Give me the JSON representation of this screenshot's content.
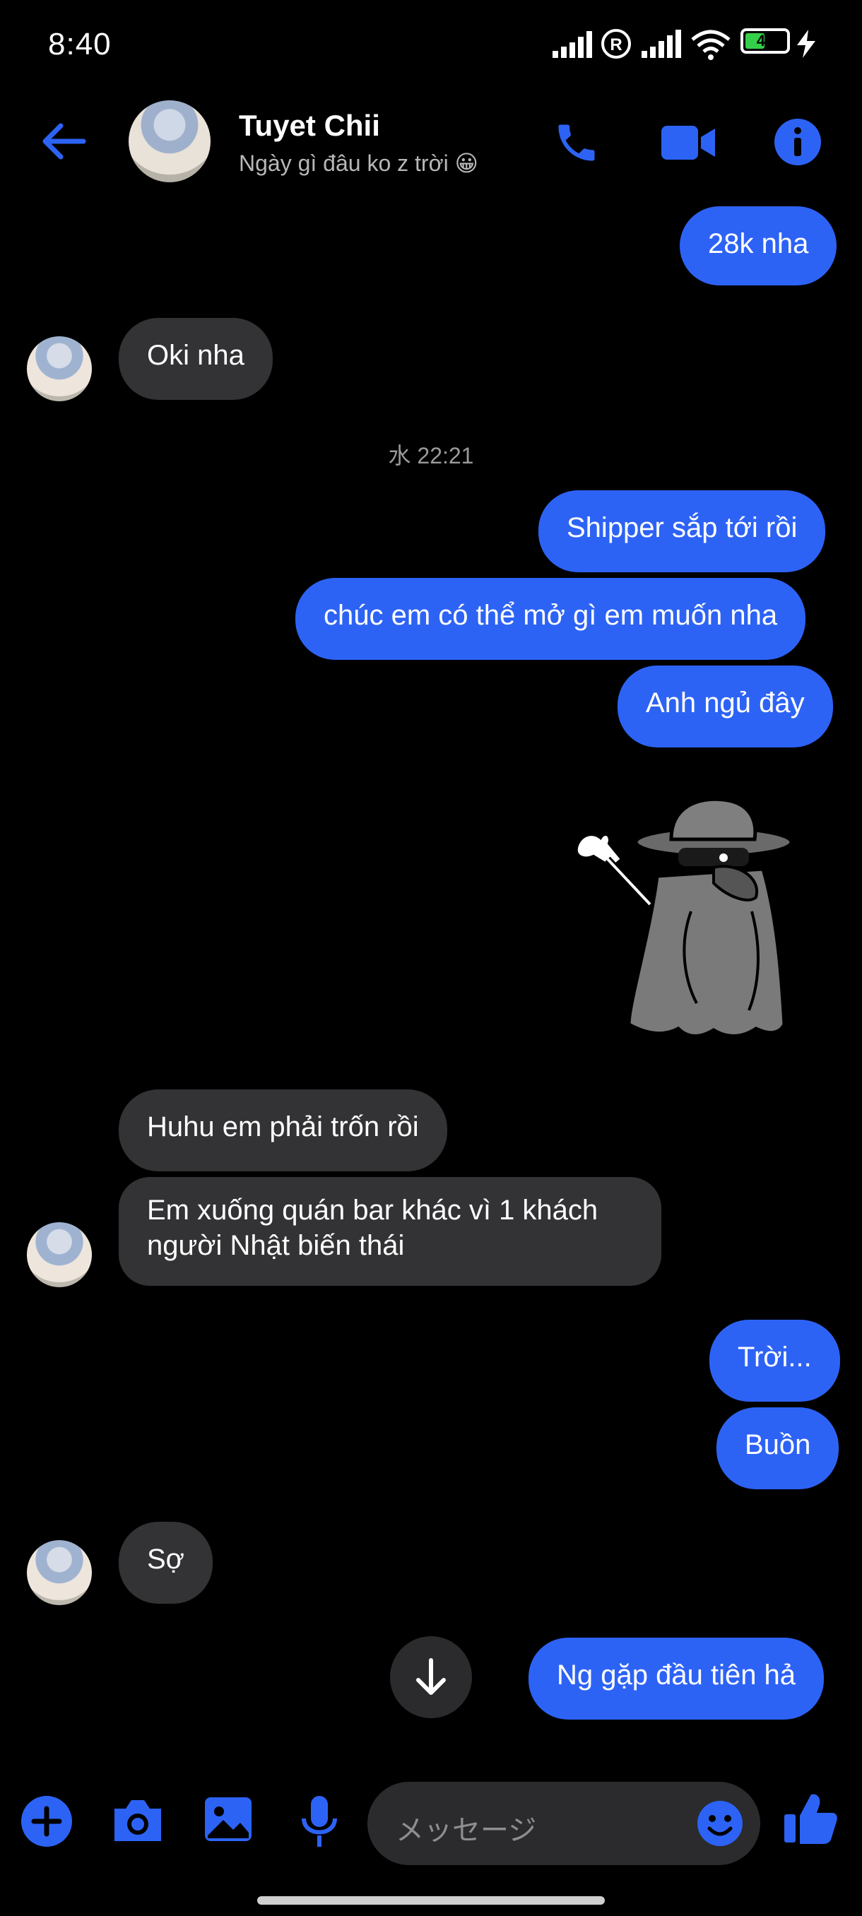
{
  "status_bar": {
    "time": "8:40",
    "battery_percent": "46"
  },
  "header": {
    "contact_name": "Tuyet Chii",
    "contact_status": "Ngày gì đâu ko z trời 😀"
  },
  "messages": {
    "m1": "28k nha",
    "m2": "Oki nha",
    "timestamp": "水 22:21",
    "m3": "Shipper sắp tới rồi",
    "m4": "chúc em có thể mở gì em muốn nha",
    "m5": "Anh ngủ đây",
    "m6": "Huhu em phải trốn rồi",
    "m7_line1": "Em xuống quán bar khác vì 1 khách",
    "m7_line2": "người Nhật biến thái",
    "m8": "Trời...",
    "m9": "Buồn",
    "m10": "Sợ",
    "m11": "Ng gặp đầu tiên hả"
  },
  "composer": {
    "placeholder": "メッセージ"
  },
  "colors": {
    "accent": "#2d63f5",
    "incoming_bubble": "#333335",
    "background": "#000000"
  }
}
